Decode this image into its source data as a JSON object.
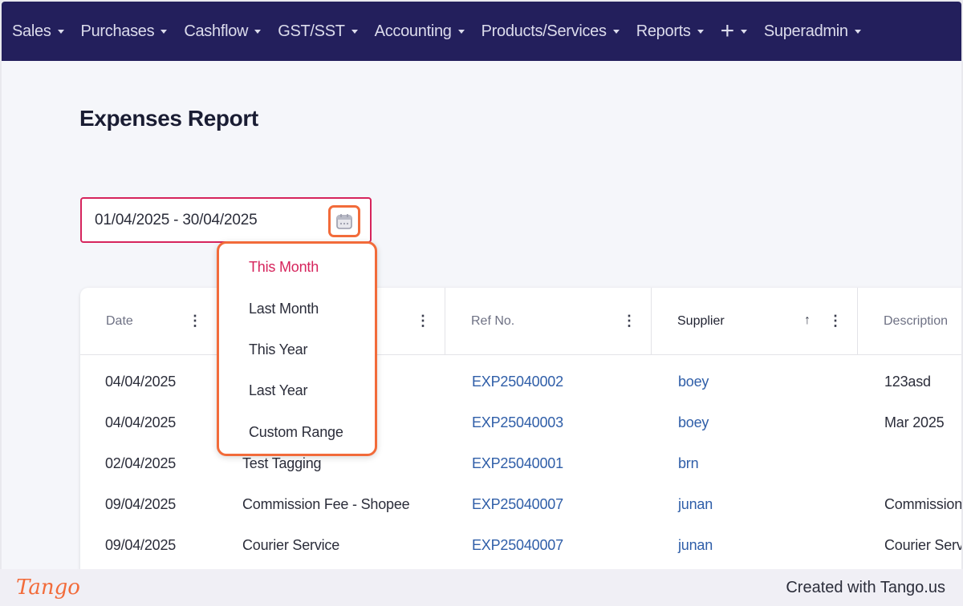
{
  "nav": {
    "items": [
      "Sales",
      "Purchases",
      "Cashflow",
      "GST/SST",
      "Accounting",
      "Products/Services",
      "Reports"
    ],
    "plus_label": "+",
    "user_label": "Superadmin"
  },
  "page": {
    "title": "Expenses Report"
  },
  "date_range": {
    "value": "01/04/2025 - 30/04/2025"
  },
  "dropdown": {
    "options": [
      "This Month",
      "Last Month",
      "This Year",
      "Last Year",
      "Custom Range"
    ],
    "selected": "This Month"
  },
  "table": {
    "headers": [
      "Date",
      "",
      "Ref No.",
      "Supplier",
      "Description"
    ],
    "sort_icon": "arrow-up-icon",
    "rows": [
      [
        "04/04/2025",
        "",
        "EXP25040002",
        "boey",
        "123asd"
      ],
      [
        "04/04/2025",
        "",
        "EXP25040003",
        "boey",
        "Mar 2025"
      ],
      [
        "02/04/2025",
        "Test Tagging",
        "EXP25040001",
        "brn",
        ""
      ],
      [
        "09/04/2025",
        "Commission Fee - Shopee",
        "EXP25040007",
        "junan",
        "Commission"
      ],
      [
        "09/04/2025",
        "Courier Service",
        "EXP25040007",
        "junan",
        "Courier Serv"
      ]
    ]
  },
  "footer": {
    "logo": "Tango",
    "created_text": "Created with Tango.us"
  },
  "colors": {
    "nav_bg": "#231f5c",
    "accent": "#d6245c",
    "highlight": "#f26b3a",
    "link": "#2f5ea8"
  }
}
